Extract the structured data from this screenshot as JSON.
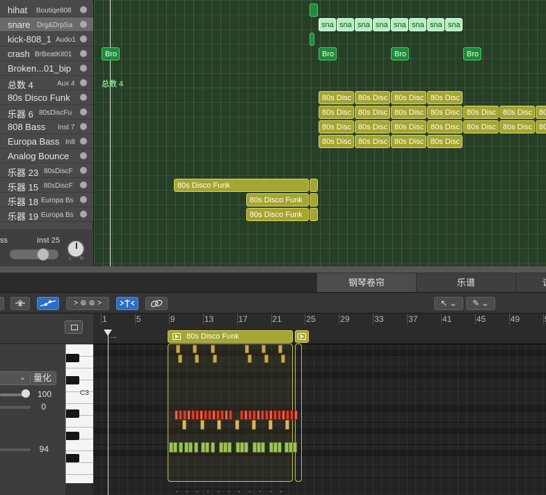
{
  "tracks": [
    {
      "name": "hihat",
      "sub": "Boutiqe808"
    },
    {
      "name": "snare",
      "sub": "Drg&DrpSa"
    },
    {
      "name": "kick-808_1",
      "sub": "Audo1"
    },
    {
      "name": "crash",
      "sub": "BrBeatKit01"
    },
    {
      "name": "Broken...01_bip",
      "sub": ""
    },
    {
      "name": "总数 4",
      "sub": "Aux 4"
    },
    {
      "name": "80s Disco Funk",
      "sub": ""
    },
    {
      "name": "乐器 6",
      "sub": "80sDiscFu"
    },
    {
      "name": "808 Bass",
      "sub": "Inst 7"
    },
    {
      "name": "Europa Bass",
      "sub": "In8"
    },
    {
      "name": "Analog Bounce",
      "sub": ""
    },
    {
      "name": "乐器 23",
      "sub": "80sDiscF"
    },
    {
      "name": "乐器 15",
      "sub": "80sDiscF"
    },
    {
      "name": "乐器 18",
      "sub": "Europa Bs"
    },
    {
      "name": "乐器 19",
      "sub": "Europa Bs"
    }
  ],
  "inspector_strip": {
    "name": "ss",
    "output": "Inst 25",
    "l": "L",
    "r": "R"
  },
  "regions": {
    "snare_label": "sna",
    "crash_label": "Bro",
    "aux_label": "总数 4",
    "disco_short": "80s Disc",
    "disco_full": "80s Disco Funk"
  },
  "tabs": {
    "piano_roll": "钢琴卷帘",
    "score": "乐谱",
    "more": "谊"
  },
  "toolbar": {
    "midi_in": "> ⊛ ⊛ >",
    "pointer_tool": "↖ ⌄",
    "pencil_tool": "✎ ⌄"
  },
  "piano_roll": {
    "quantize_label": "量化",
    "velocity_value": "100",
    "offset_value": "0",
    "note_value": "94",
    "c3_label": "C3",
    "region_name": "80s Disco Funk",
    "start_marker": "..."
  },
  "ruler_bars": [
    "1",
    "5",
    "9",
    "13",
    "17",
    "21",
    "25",
    "29",
    "33",
    "37",
    "41",
    "45",
    "49",
    "5"
  ],
  "colors": {
    "track_bg": "#263f26",
    "olive_region": "#a5a530",
    "mint_region": "#b5f0c0",
    "green_region": "#1f8b3a",
    "tab_active": "#2c6fc3"
  }
}
